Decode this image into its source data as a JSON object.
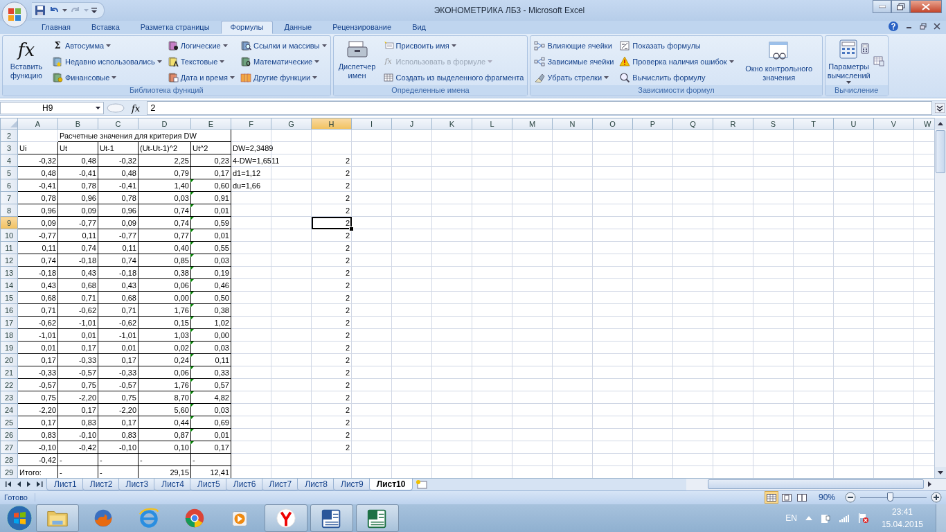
{
  "window": {
    "title": "ЭКОНОМЕТРИКА ЛБ3 - Microsoft Excel"
  },
  "tabs": [
    {
      "label": "Главная",
      "selected": false
    },
    {
      "label": "Вставка",
      "selected": false
    },
    {
      "label": "Разметка страницы",
      "selected": false
    },
    {
      "label": "Формулы",
      "selected": true
    },
    {
      "label": "Данные",
      "selected": false
    },
    {
      "label": "Рецензирование",
      "selected": false
    },
    {
      "label": "Вид",
      "selected": false
    }
  ],
  "ribbon": {
    "groups": [
      {
        "label": "Библиотека функций",
        "items": [
          {
            "label": "Вставить функцию",
            "kind": "large",
            "glyph": "fx",
            "dropdown": false,
            "disabled": false
          },
          {
            "label": "Автосумма",
            "kind": "small",
            "glyph": "Σ",
            "dropdown": true,
            "disabled": false
          },
          {
            "label": "Недавно использовались",
            "kind": "small",
            "dropdown": true,
            "disabled": false
          },
          {
            "label": "Финансовые",
            "kind": "small",
            "dropdown": true,
            "disabled": false
          },
          {
            "label": "Логические",
            "kind": "small",
            "dropdown": true,
            "disabled": false
          },
          {
            "label": "Текстовые",
            "kind": "small",
            "dropdown": true,
            "disabled": false
          },
          {
            "label": "Дата и время",
            "kind": "small",
            "dropdown": true,
            "disabled": false
          },
          {
            "label": "Ссылки и массивы",
            "kind": "small",
            "dropdown": true,
            "disabled": false
          },
          {
            "label": "Математические",
            "kind": "small",
            "dropdown": true,
            "disabled": false
          },
          {
            "label": "Другие функции",
            "kind": "small",
            "dropdown": true,
            "disabled": false
          }
        ]
      },
      {
        "label": "Определенные имена",
        "items": [
          {
            "label": "Диспетчер имен",
            "kind": "large",
            "dropdown": false,
            "disabled": false
          },
          {
            "label": "Присвоить имя",
            "kind": "small",
            "dropdown": true,
            "disabled": false
          },
          {
            "label": "Использовать в формуле",
            "kind": "small",
            "glyph": "fx",
            "dropdown": true,
            "disabled": true
          },
          {
            "label": "Создать из выделенного фрагмента",
            "kind": "small",
            "dropdown": false,
            "disabled": false
          }
        ]
      },
      {
        "label": "Зависимости формул",
        "items": [
          {
            "label": "Влияющие ячейки",
            "kind": "small",
            "dropdown": false,
            "disabled": false
          },
          {
            "label": "Зависимые ячейки",
            "kind": "small",
            "dropdown": false,
            "disabled": false
          },
          {
            "label": "Убрать стрелки",
            "kind": "small",
            "dropdown": true,
            "disabled": false
          },
          {
            "label": "Показать формулы",
            "kind": "small",
            "dropdown": false,
            "disabled": false
          },
          {
            "label": "Проверка наличия ошибок",
            "kind": "small",
            "dropdown": true,
            "disabled": false
          },
          {
            "label": "Вычислить формулу",
            "kind": "small",
            "dropdown": false,
            "disabled": false
          },
          {
            "label": "Окно контрольного значения",
            "kind": "large",
            "dropdown": false,
            "disabled": false
          }
        ]
      },
      {
        "label": "Вычисление",
        "items": [
          {
            "label": "Параметры вычислений",
            "kind": "large",
            "dropdown": true,
            "disabled": false
          },
          {
            "kind": "icon",
            "disabled": false
          },
          {
            "kind": "icon",
            "disabled": false
          }
        ]
      }
    ]
  },
  "formula_bar": {
    "name_box": "H9",
    "fx_label": "fx",
    "value": "2"
  },
  "sheet": {
    "columns": [
      {
        "label": "A",
        "selected": false
      },
      {
        "label": "B",
        "selected": false
      },
      {
        "label": "C",
        "selected": false
      },
      {
        "label": "D",
        "selected": false
      },
      {
        "label": "E",
        "selected": false
      },
      {
        "label": "F",
        "selected": false
      },
      {
        "label": "G",
        "selected": false
      },
      {
        "label": "H",
        "selected": true
      },
      {
        "label": "I",
        "selected": false
      },
      {
        "label": "J",
        "selected": false
      },
      {
        "label": "K",
        "selected": false
      },
      {
        "label": "L",
        "selected": false
      },
      {
        "label": "M",
        "selected": false
      },
      {
        "label": "N",
        "selected": false
      },
      {
        "label": "O",
        "selected": false
      },
      {
        "label": "P",
        "selected": false
      },
      {
        "label": "Q",
        "selected": false
      },
      {
        "label": "R",
        "selected": false
      },
      {
        "label": "S",
        "selected": false
      },
      {
        "label": "T",
        "selected": false
      },
      {
        "label": "U",
        "selected": false
      },
      {
        "label": "V",
        "selected": false
      },
      {
        "label": "W",
        "selected": false
      }
    ],
    "rows": [
      {
        "number": "2",
        "kind": "title",
        "selected": false,
        "flag": false,
        "cells": {
          "b": "Расчетные значения для критерия DW"
        }
      },
      {
        "number": "3",
        "kind": "header",
        "selected": false,
        "flag": false,
        "cells": {
          "a": "Ui",
          "b": "Ut",
          "c": "Ut-1",
          "d": "(Ut-Ut-1)^2",
          "e": "Ut^2",
          "f": "DW=2,3489"
        }
      },
      {
        "number": "4",
        "kind": "data",
        "selected": false,
        "flag": false,
        "cells": {
          "a": "-0,32",
          "b": "0,48",
          "c": "-0,32",
          "d": "2,25",
          "e": "0,23",
          "f": "4-DW=1,6511",
          "h": "2"
        }
      },
      {
        "number": "5",
        "kind": "data",
        "selected": false,
        "flag": false,
        "cells": {
          "a": "0,48",
          "b": "-0,41",
          "c": "0,48",
          "d": "0,79",
          "e": "0,17",
          "f": "d1=1,12",
          "h": "2"
        }
      },
      {
        "number": "6",
        "kind": "data",
        "selected": false,
        "flag": true,
        "cells": {
          "a": "-0,41",
          "b": "0,78",
          "c": "-0,41",
          "d": "1,40",
          "e": "0,60",
          "f": "du=1,66",
          "h": "2"
        }
      },
      {
        "number": "7",
        "kind": "data",
        "selected": false,
        "flag": true,
        "cells": {
          "a": "0,78",
          "b": "0,96",
          "c": "0,78",
          "d": "0,03",
          "e": "0,91",
          "h": "2"
        }
      },
      {
        "number": "8",
        "kind": "data",
        "selected": false,
        "flag": true,
        "cells": {
          "a": "0,96",
          "b": "0,09",
          "c": "0,96",
          "d": "0,74",
          "e": "0,01",
          "h": "2"
        }
      },
      {
        "number": "9",
        "kind": "data",
        "selected": true,
        "flag": true,
        "cells": {
          "a": "0,09",
          "b": "-0,77",
          "c": "0,09",
          "d": "0,74",
          "e": "0,59",
          "h": "2"
        }
      },
      {
        "number": "10",
        "kind": "data",
        "selected": false,
        "flag": true,
        "cells": {
          "a": "-0,77",
          "b": "0,11",
          "c": "-0,77",
          "d": "0,77",
          "e": "0,01",
          "h": "2"
        }
      },
      {
        "number": "11",
        "kind": "data",
        "selected": false,
        "flag": true,
        "cells": {
          "a": "0,11",
          "b": "0,74",
          "c": "0,11",
          "d": "0,40",
          "e": "0,55",
          "h": "2"
        }
      },
      {
        "number": "12",
        "kind": "data",
        "selected": false,
        "flag": true,
        "cells": {
          "a": "0,74",
          "b": "-0,18",
          "c": "0,74",
          "d": "0,85",
          "e": "0,03",
          "h": "2"
        }
      },
      {
        "number": "13",
        "kind": "data",
        "selected": false,
        "flag": true,
        "cells": {
          "a": "-0,18",
          "b": "0,43",
          "c": "-0,18",
          "d": "0,38",
          "e": "0,19",
          "h": "2"
        }
      },
      {
        "number": "14",
        "kind": "data",
        "selected": false,
        "flag": true,
        "cells": {
          "a": "0,43",
          "b": "0,68",
          "c": "0,43",
          "d": "0,06",
          "e": "0,46",
          "h": "2"
        }
      },
      {
        "number": "15",
        "kind": "data",
        "selected": false,
        "flag": true,
        "cells": {
          "a": "0,68",
          "b": "0,71",
          "c": "0,68",
          "d": "0,00",
          "e": "0,50",
          "h": "2"
        }
      },
      {
        "number": "16",
        "kind": "data",
        "selected": false,
        "flag": true,
        "cells": {
          "a": "0,71",
          "b": "-0,62",
          "c": "0,71",
          "d": "1,76",
          "e": "0,38",
          "h": "2"
        }
      },
      {
        "number": "17",
        "kind": "data",
        "selected": false,
        "flag": true,
        "cells": {
          "a": "-0,62",
          "b": "-1,01",
          "c": "-0,62",
          "d": "0,15",
          "e": "1,02",
          "h": "2"
        }
      },
      {
        "number": "18",
        "kind": "data",
        "selected": false,
        "flag": true,
        "cells": {
          "a": "-1,01",
          "b": "0,01",
          "c": "-1,01",
          "d": "1,03",
          "e": "0,00",
          "h": "2"
        }
      },
      {
        "number": "19",
        "kind": "data",
        "selected": false,
        "flag": true,
        "cells": {
          "a": "0,01",
          "b": "0,17",
          "c": "0,01",
          "d": "0,02",
          "e": "0,03",
          "h": "2"
        }
      },
      {
        "number": "20",
        "kind": "data",
        "selected": false,
        "flag": true,
        "cells": {
          "a": "0,17",
          "b": "-0,33",
          "c": "0,17",
          "d": "0,24",
          "e": "0,11",
          "h": "2"
        }
      },
      {
        "number": "21",
        "kind": "data",
        "selected": false,
        "flag": true,
        "cells": {
          "a": "-0,33",
          "b": "-0,57",
          "c": "-0,33",
          "d": "0,06",
          "e": "0,33",
          "h": "2"
        }
      },
      {
        "number": "22",
        "kind": "data",
        "selected": false,
        "flag": true,
        "cells": {
          "a": "-0,57",
          "b": "0,75",
          "c": "-0,57",
          "d": "1,76",
          "e": "0,57",
          "h": "2"
        }
      },
      {
        "number": "23",
        "kind": "data",
        "selected": false,
        "flag": true,
        "cells": {
          "a": "0,75",
          "b": "-2,20",
          "c": "0,75",
          "d": "8,70",
          "e": "4,82",
          "h": "2"
        }
      },
      {
        "number": "24",
        "kind": "data",
        "selected": false,
        "flag": true,
        "cells": {
          "a": "-2,20",
          "b": "0,17",
          "c": "-2,20",
          "d": "5,60",
          "e": "0,03",
          "h": "2"
        }
      },
      {
        "number": "25",
        "kind": "data",
        "selected": false,
        "flag": true,
        "cells": {
          "a": "0,17",
          "b": "0,83",
          "c": "0,17",
          "d": "0,44",
          "e": "0,69",
          "h": "2"
        }
      },
      {
        "number": "26",
        "kind": "data",
        "selected": false,
        "flag": true,
        "cells": {
          "a": "0,83",
          "b": "-0,10",
          "c": "0,83",
          "d": "0,87",
          "e": "0,01",
          "h": "2"
        }
      },
      {
        "number": "27",
        "kind": "data",
        "selected": false,
        "flag": true,
        "cells": {
          "a": "-0,10",
          "b": "-0,42",
          "c": "-0,10",
          "d": "0,10",
          "e": "0,17",
          "h": "2"
        }
      },
      {
        "number": "28",
        "kind": "dash",
        "selected": false,
        "flag": false,
        "cells": {
          "a": "-0,42",
          "b": "-",
          "c": "-",
          "d": "-",
          "e": "-"
        }
      },
      {
        "number": "29",
        "kind": "total",
        "selected": false,
        "flag": false,
        "cells": {
          "a": "Итого:",
          "b": "-",
          "c": "-",
          "d": "29,15",
          "e": "12,41"
        }
      }
    ]
  },
  "sheet_tabs": [
    {
      "label": "Лист1",
      "selected": false
    },
    {
      "label": "Лист2",
      "selected": false
    },
    {
      "label": "Лист3",
      "selected": false
    },
    {
      "label": "Лист4",
      "selected": false
    },
    {
      "label": "Лист5",
      "selected": false
    },
    {
      "label": "Лист6",
      "selected": false
    },
    {
      "label": "Лист7",
      "selected": false
    },
    {
      "label": "Лист8",
      "selected": false
    },
    {
      "label": "Лист9",
      "selected": false
    },
    {
      "label": "Лист10",
      "selected": true
    }
  ],
  "status_bar": {
    "text": "Готово",
    "views": [
      {
        "selected": true
      },
      {
        "selected": false
      },
      {
        "selected": false
      }
    ],
    "zoom": {
      "label": "90%",
      "level": 0.45
    }
  },
  "taskbar": {
    "apps": [
      {
        "open": true
      },
      {
        "open": false
      },
      {
        "open": false
      },
      {
        "open": false
      },
      {
        "open": false
      },
      {
        "open": true
      },
      {
        "open": true
      },
      {
        "open": true
      }
    ],
    "language": "EN",
    "time": "23:41",
    "date": "15.04.2015"
  }
}
